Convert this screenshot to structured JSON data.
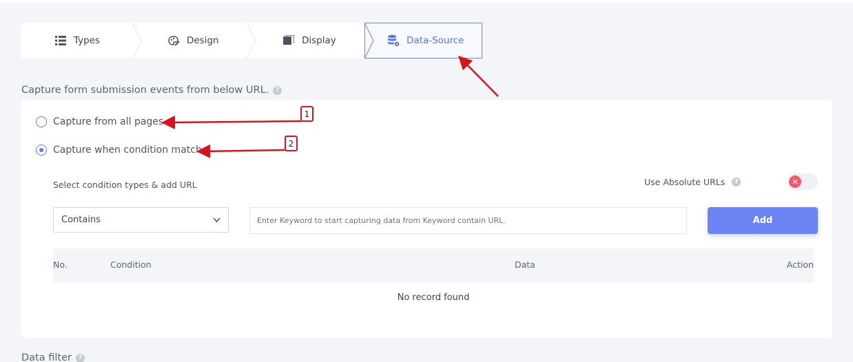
{
  "tabs": [
    {
      "label": "Types",
      "icon": "list-icon"
    },
    {
      "label": "Design",
      "icon": "palette-icon"
    },
    {
      "label": "Display",
      "icon": "display-icon"
    },
    {
      "label": "Data-Source",
      "icon": "database-gear-icon",
      "active": true
    }
  ],
  "capture": {
    "title": "Capture form submission events from below URL.",
    "options": [
      {
        "label": "Capture from all pages",
        "selected": false
      },
      {
        "label": "Capture when condition match",
        "selected": true
      }
    ],
    "condition_label": "Select condition types & add URL",
    "absolute_urls_label": "Use Absolute URLs",
    "absolute_urls_enabled": false,
    "select_value": "Contains",
    "keyword_placeholder": "Enter Keyword to start capturing data from Keyword contain URL.",
    "add_label": "Add",
    "table": {
      "columns": [
        "No.",
        "Condition",
        "Data",
        "Action"
      ],
      "empty_text": "No record found"
    }
  },
  "next_section_title": "Data filter",
  "annotations": [
    "1",
    "2"
  ],
  "colors": {
    "accent": "#6b84f4",
    "annotation": "#d7141c",
    "toggle_off": "#ef5b6c"
  }
}
